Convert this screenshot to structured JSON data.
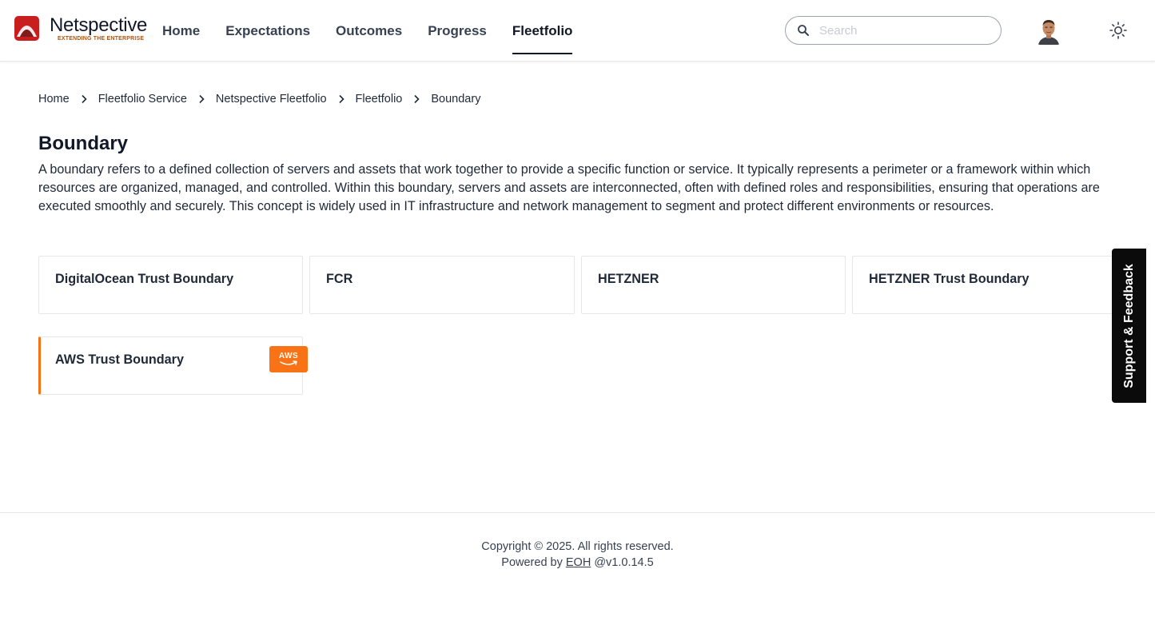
{
  "brand": {
    "name": "Netspective",
    "tagline": "EXTENDING THE ENTERPRISE",
    "logo_color": "#c81e1e"
  },
  "nav": {
    "items": [
      {
        "label": "Home",
        "active": false
      },
      {
        "label": "Expectations",
        "active": false
      },
      {
        "label": "Outcomes",
        "active": false
      },
      {
        "label": "Progress",
        "active": false
      },
      {
        "label": "Fleetfolio",
        "active": true
      }
    ]
  },
  "search": {
    "placeholder": "Search",
    "value": ""
  },
  "breadcrumb": {
    "items": [
      "Home",
      "Fleetfolio Service",
      "Netspective Fleetfolio",
      "Fleetfolio",
      "Boundary"
    ]
  },
  "page": {
    "title": "Boundary",
    "description": "A boundary refers to a defined collection of servers and assets that work together to provide a specific function or service. It typically represents a perimeter or a framework within which resources are organized, managed, and controlled. Within this boundary, servers and assets are interconnected, often with defined roles and responsibilities, ensuring that operations are executed smoothly and securely. This concept is widely used in IT infrastructure and network management to segment and protect different environments or resources."
  },
  "boundaries": [
    {
      "name": "DigitalOcean Trust Boundary"
    },
    {
      "name": "FCR"
    },
    {
      "name": "HETZNER"
    },
    {
      "name": "HETZNER Trust Boundary"
    },
    {
      "name": "AWS Trust Boundary",
      "badge": "AWS",
      "selected": true
    }
  ],
  "feedback": {
    "label": "Support & Feedback"
  },
  "footer": {
    "copyright": "Copyright © 2025. All rights reserved.",
    "powered_prefix": "Powered by ",
    "powered_link": "EOH",
    "version": " @v1.0.14.5"
  },
  "colors": {
    "accent": "#f97316",
    "text": "#1f2937",
    "border": "#e5e7eb"
  }
}
